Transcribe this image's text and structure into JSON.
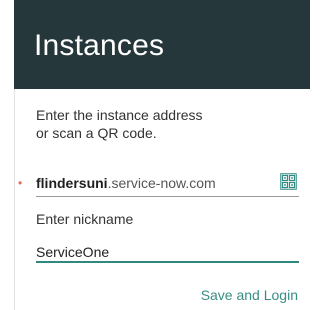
{
  "header": {
    "title": "Instances"
  },
  "instructions": {
    "line1": "Enter the instance address",
    "line2": "or scan a QR code."
  },
  "address": {
    "main": "flindersuni",
    "rest": ".service-now.com",
    "marker": "•",
    "qr_icon": "qr-code-icon"
  },
  "nickname": {
    "label": "Enter nickname",
    "value": "ServiceOne"
  },
  "actions": {
    "save_login_label": "Save and Login"
  },
  "colors": {
    "header_bg": "#26373c",
    "accent": "#3a8d85",
    "marker": "#e66a55"
  }
}
